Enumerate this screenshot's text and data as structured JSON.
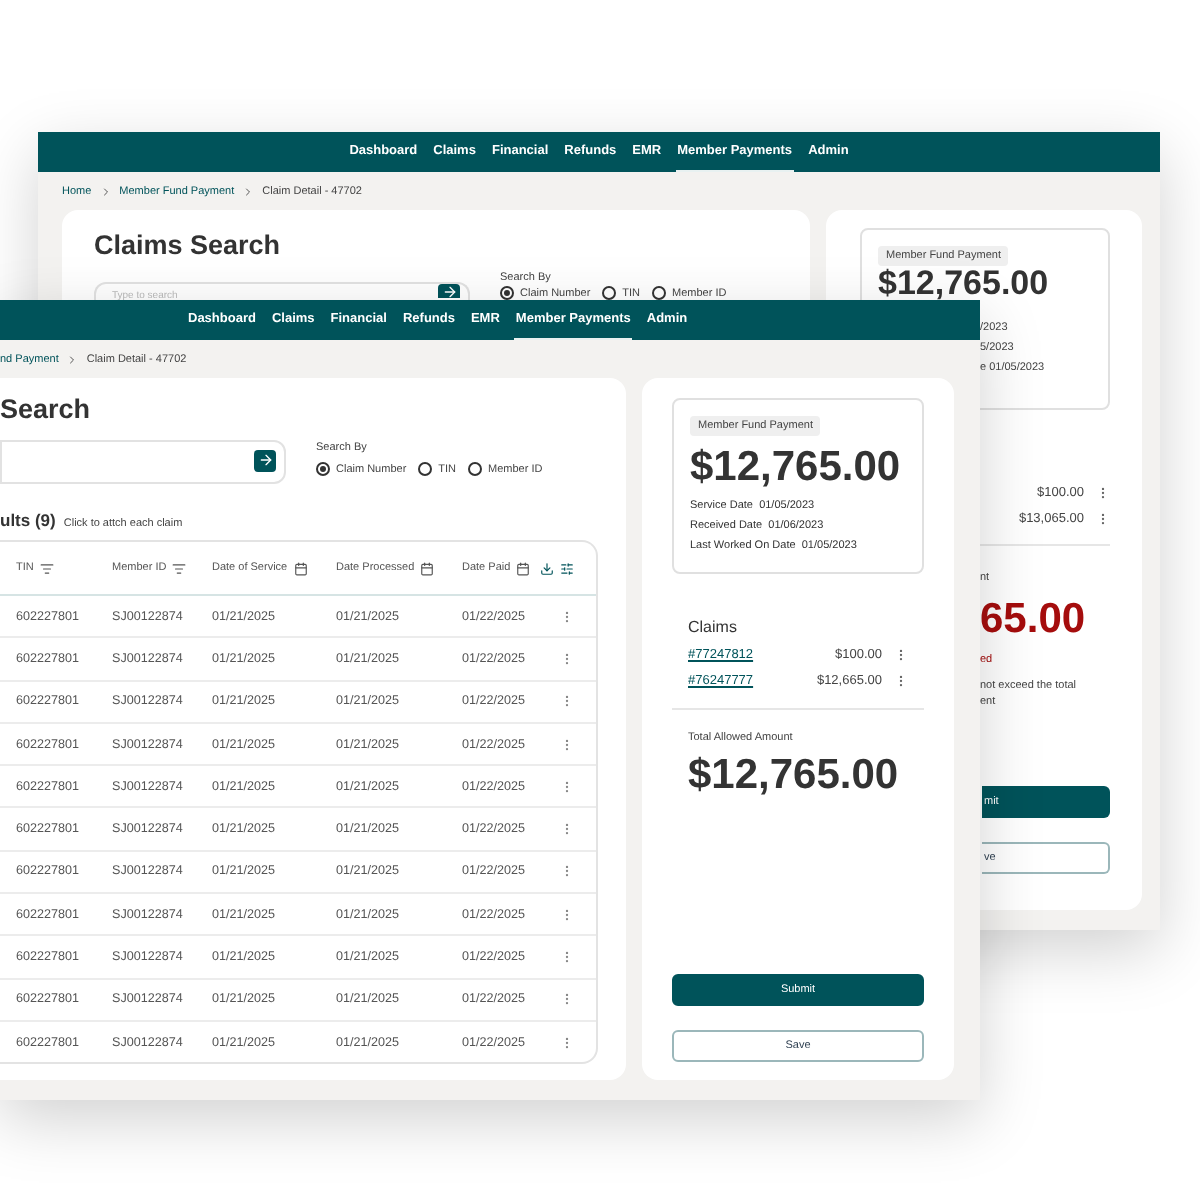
{
  "back_window": {
    "nav": [
      {
        "label": "Dashboard",
        "selected": false
      },
      {
        "label": "Claims",
        "selected": false
      },
      {
        "label": "Financial",
        "selected": false
      },
      {
        "label": "Refunds",
        "selected": false
      },
      {
        "label": "EMR",
        "selected": false
      },
      {
        "label": "Member Payments",
        "selected": true
      },
      {
        "label": "Admin",
        "selected": false
      }
    ],
    "breadcrumb": [
      {
        "label": "Home",
        "kind": "link"
      },
      {
        "label": "Member Fund Payment",
        "kind": "link"
      },
      {
        "label": "Claim Detail - 47702",
        "kind": "current"
      }
    ],
    "title": "Claims Search",
    "search": {
      "placeholder": "Type to search"
    },
    "search_by": {
      "label": "Search By",
      "options": [
        {
          "label": "Claim Number",
          "selected": true
        },
        {
          "label": "TIN",
          "selected": false
        },
        {
          "label": "Member ID",
          "selected": false
        }
      ]
    },
    "payment": {
      "tag": "Member Fund Payment",
      "amount": "$12,765.00",
      "date_fragments": [
        "/2023",
        "5/2023",
        "e 01/05/2023"
      ]
    },
    "claim_amounts": [
      "$100.00",
      "$13,065.00"
    ],
    "total": {
      "label": "nt",
      "amount": "65.00",
      "note": "ed",
      "message": [
        "not exceed the total",
        "ent"
      ]
    },
    "buttons": [
      {
        "label": "mit",
        "kind": "primary"
      },
      {
        "label": "ve",
        "kind": "secondary"
      }
    ]
  },
  "front_window": {
    "nav": [
      {
        "label": "Dashboard",
        "selected": false
      },
      {
        "label": "Claims",
        "selected": false
      },
      {
        "label": "Financial",
        "selected": false
      },
      {
        "label": "Refunds",
        "selected": false
      },
      {
        "label": "EMR",
        "selected": false
      },
      {
        "label": "Member Payments",
        "selected": true
      },
      {
        "label": "Admin",
        "selected": false
      }
    ],
    "breadcrumb": [
      {
        "label": "nd Payment",
        "kind": "link"
      },
      {
        "label": "Claim Detail - 47702",
        "kind": "current"
      }
    ],
    "title": "Search",
    "search_by": {
      "label": "Search By",
      "options": [
        {
          "label": "Claim Number",
          "selected": true
        },
        {
          "label": "TIN",
          "selected": false
        },
        {
          "label": "Member ID",
          "selected": false
        }
      ]
    },
    "results": {
      "title": "ults (9)",
      "hint": "Click to attch each claim"
    },
    "table": {
      "columns": [
        "TIN",
        "Member ID",
        "Date of Service",
        "Date Processed",
        "Date Paid"
      ],
      "rows": [
        [
          "602227801",
          "SJ00122874",
          "01/21/2025",
          "01/21/2025",
          "01/22/2025"
        ],
        [
          "602227801",
          "SJ00122874",
          "01/21/2025",
          "01/21/2025",
          "01/22/2025"
        ],
        [
          "602227801",
          "SJ00122874",
          "01/21/2025",
          "01/21/2025",
          "01/22/2025"
        ],
        [
          "602227801",
          "SJ00122874",
          "01/21/2025",
          "01/21/2025",
          "01/22/2025"
        ],
        [
          "602227801",
          "SJ00122874",
          "01/21/2025",
          "01/21/2025",
          "01/22/2025"
        ],
        [
          "602227801",
          "SJ00122874",
          "01/21/2025",
          "01/21/2025",
          "01/22/2025"
        ],
        [
          "602227801",
          "SJ00122874",
          "01/21/2025",
          "01/21/2025",
          "01/22/2025"
        ],
        [
          "602227801",
          "SJ00122874",
          "01/21/2025",
          "01/21/2025",
          "01/22/2025"
        ],
        [
          "602227801",
          "SJ00122874",
          "01/21/2025",
          "01/21/2025",
          "01/22/2025"
        ],
        [
          "602227801",
          "SJ00122874",
          "01/21/2025",
          "01/21/2025",
          "01/22/2025"
        ],
        [
          "602227801",
          "SJ00122874",
          "01/21/2025",
          "01/21/2025",
          "01/22/2025"
        ]
      ]
    },
    "payment": {
      "tag": "Member Fund Payment",
      "amount": "$12,765.00",
      "dates": [
        {
          "label": "Service Date",
          "value": "01/05/2023"
        },
        {
          "label": "Received Date",
          "value": "01/06/2023"
        },
        {
          "label": "Last Worked On Date",
          "value": "01/05/2023"
        }
      ]
    },
    "claims": {
      "title": "Claims",
      "items": [
        {
          "id": "#77247812",
          "amount": "$100.00"
        },
        {
          "id": "#76247777",
          "amount": "$12,665.00"
        }
      ]
    },
    "total": {
      "label": "Total Allowed Amount",
      "amount": "$12,765.00"
    },
    "buttons": [
      {
        "label": "Submit",
        "kind": "primary"
      },
      {
        "label": "Save",
        "kind": "secondary"
      }
    ]
  }
}
